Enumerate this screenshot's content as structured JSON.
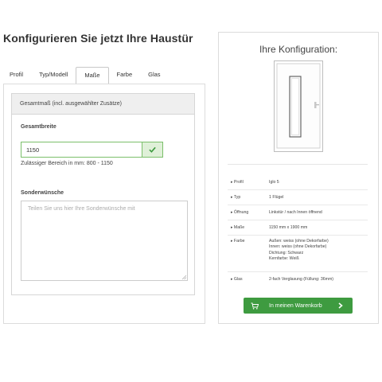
{
  "header": {
    "title": "Konfigurieren Sie jetzt Ihre Haustür"
  },
  "tabs": [
    {
      "label": "Profil",
      "active": false
    },
    {
      "label": "Typ/Modell",
      "active": false
    },
    {
      "label": "Maße",
      "active": true
    },
    {
      "label": "Farbe",
      "active": false
    },
    {
      "label": "Glas",
      "active": false
    }
  ],
  "form": {
    "section_title": "Gesamtmaß (incl. ausgewählter Zusätze)",
    "width_label": "Gesamtbreite",
    "width_value": "1150",
    "width_valid_icon": "check-icon",
    "range_hint": "Zulässiger Bereich in mm: 800 - 1150",
    "wishes_label": "Sonderwünsche",
    "wishes_value": "",
    "wishes_placeholder": "Teilen Sie uns hier Ihre Sonderwünsche mit"
  },
  "summary": {
    "title": "Ihre Konfiguration:",
    "rows": [
      {
        "key": "Profil",
        "value": "Iglo 5"
      },
      {
        "key": "Typ",
        "value": "1 Flügel"
      },
      {
        "key": "Öffnung",
        "value": "Linkstür / nach Innen öffnend"
      },
      {
        "key": "Maße",
        "value": "1150 mm x 1900 mm"
      },
      {
        "key": "Farbe",
        "value": "Außen: weiss (ohne Dekorfarbe)\nInnen: weiss (ohne Dekorfarbe)\nDichtung: Schwarz\nKernfarbe: Weiß"
      },
      {
        "key": "Glas",
        "value": "2-fach Verglasung (Füllung: 36mm)"
      }
    ],
    "cart_button": "In meinen Warenkorb",
    "cart_icon": "cart-icon",
    "cart_arrow_icon": "chevron-right-icon"
  },
  "colors": {
    "accent_green": "#3e9b40",
    "valid_green": "#7bbf6a",
    "valid_bg": "#dff0d8"
  }
}
